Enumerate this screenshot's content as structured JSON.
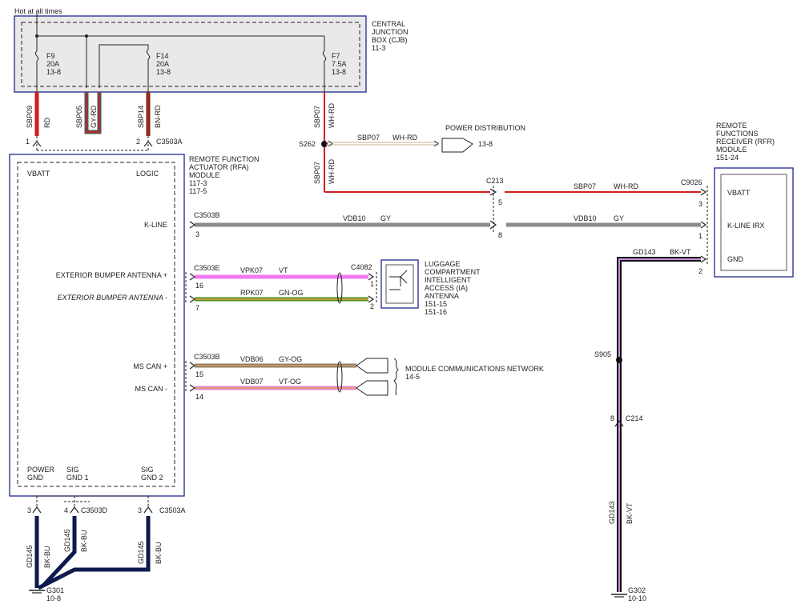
{
  "header": {
    "hot_label": "Hot at all times"
  },
  "cjb": {
    "title": [
      "CENTRAL",
      "JUNCTION",
      "BOX (CJB)",
      "11-3"
    ],
    "fuses": [
      {
        "name": "F9",
        "rating": "20A",
        "ref": "13-8"
      },
      {
        "name": "F14",
        "rating": "20A",
        "ref": "13-8"
      },
      {
        "name": "F7",
        "rating": "7.5A",
        "ref": "13-8"
      }
    ]
  },
  "wires": {
    "sbp09": {
      "circuit": "SBP09",
      "color": "RD"
    },
    "sbp05": {
      "circuit": "SBP05",
      "color": "GY-RD"
    },
    "sbp14": {
      "circuit": "SBP14",
      "color": "BN-RD"
    },
    "sbp07_top": {
      "circuit": "SBP07",
      "color": "WH-RD"
    },
    "sbp07_mid": {
      "circuit": "SBP07",
      "color": "WH-RD"
    },
    "sbp07_pd": {
      "circuit": "SBP07",
      "color": "WH-RD"
    },
    "sbp07_right": {
      "circuit": "SBP07",
      "color": "WH-RD"
    },
    "vdb10_left": {
      "circuit": "VDB10",
      "color": "GY"
    },
    "vdb10_right": {
      "circuit": "VDB10",
      "color": "GY"
    },
    "vpk07": {
      "circuit": "VPK07",
      "color": "VT"
    },
    "rpk07": {
      "circuit": "RPK07",
      "color": "GN-OG"
    },
    "vdb06": {
      "circuit": "VDB06",
      "color": "GY-OG"
    },
    "vdb07": {
      "circuit": "VDB07",
      "color": "VT-OG"
    },
    "gd143_top": {
      "circuit": "GD143",
      "color": "BK-VT"
    },
    "gd143_bot": {
      "circuit": "GD143",
      "color": "BK-VT"
    },
    "gd145_a": {
      "circuit": "GD145",
      "color": "BK-BU"
    },
    "gd145_b": {
      "circuit": "GD145",
      "color": "BK-BU"
    },
    "gd145_c": {
      "circuit": "GD145",
      "color": "BK-BU"
    }
  },
  "splices": {
    "s262": "S262",
    "s905": "S905"
  },
  "power_distribution": {
    "title": "POWER DISTRIBUTION",
    "ref": "13-8"
  },
  "rfa": {
    "title": [
      "REMOTE FUNCTION",
      "ACTUATOR (RFA)",
      "MODULE",
      "117-3",
      "117-5"
    ],
    "pins": {
      "vbatt": "VBATT",
      "logic": "LOGIC",
      "kline": "K-LINE",
      "ext_pos": "EXTERIOR BUMPER ANTENNA +",
      "ext_neg": "EXTERIOR BUMPER ANTENNA -",
      "mscan_pos": "MS CAN +",
      "mscan_neg": "MS CAN -",
      "power_gnd": [
        "POWER",
        "GND"
      ],
      "sig_gnd1": [
        "SIG",
        "GND 1"
      ],
      "sig_gnd2": [
        "SIG",
        "GND 2"
      ]
    }
  },
  "rfr": {
    "title": [
      "REMOTE",
      "FUNCTIONS",
      "RECEIVER (RFR)",
      "MODULE",
      "151-24"
    ],
    "pins": {
      "vbatt": "VBATT",
      "kline": "K-LINE IRX",
      "gnd": "GND"
    }
  },
  "antenna": {
    "title": [
      "LUGGAGE",
      "COMPARTMENT",
      "INTELLIGENT",
      "ACCESS (IA)",
      "ANTENNA",
      "151-15",
      "151-16"
    ]
  },
  "mcn": {
    "title": "MODULE COMMUNICATIONS NETWORK",
    "ref": "14-5"
  },
  "connectors": {
    "c3503a_top": "C3503A",
    "c3503b": "C3503B",
    "c3503e": "C3503E",
    "c3503b_can": "C3503B",
    "c3503d": "C3503D",
    "c3503a_bot": "C3503A",
    "c213": "C213",
    "c9026": "C9026",
    "c4082": "C4082",
    "c214": "C214"
  },
  "pins": {
    "p1": "1",
    "p2": "2",
    "p3_kline": "3",
    "p16": "16",
    "p7": "7",
    "p15": "15",
    "p14": "14",
    "p5": "5",
    "p8_c213": "8",
    "rfr3": "3",
    "rfr1": "1",
    "rfr2": "2",
    "ant1": "1",
    "ant2": "2",
    "gnd3a": "3",
    "gnd4": "4",
    "gnd3b": "3",
    "c214_8": "8"
  },
  "grounds": {
    "g301": "G301",
    "g301_ref": "10-8",
    "g302": "G302",
    "g302_ref": "10-10"
  }
}
